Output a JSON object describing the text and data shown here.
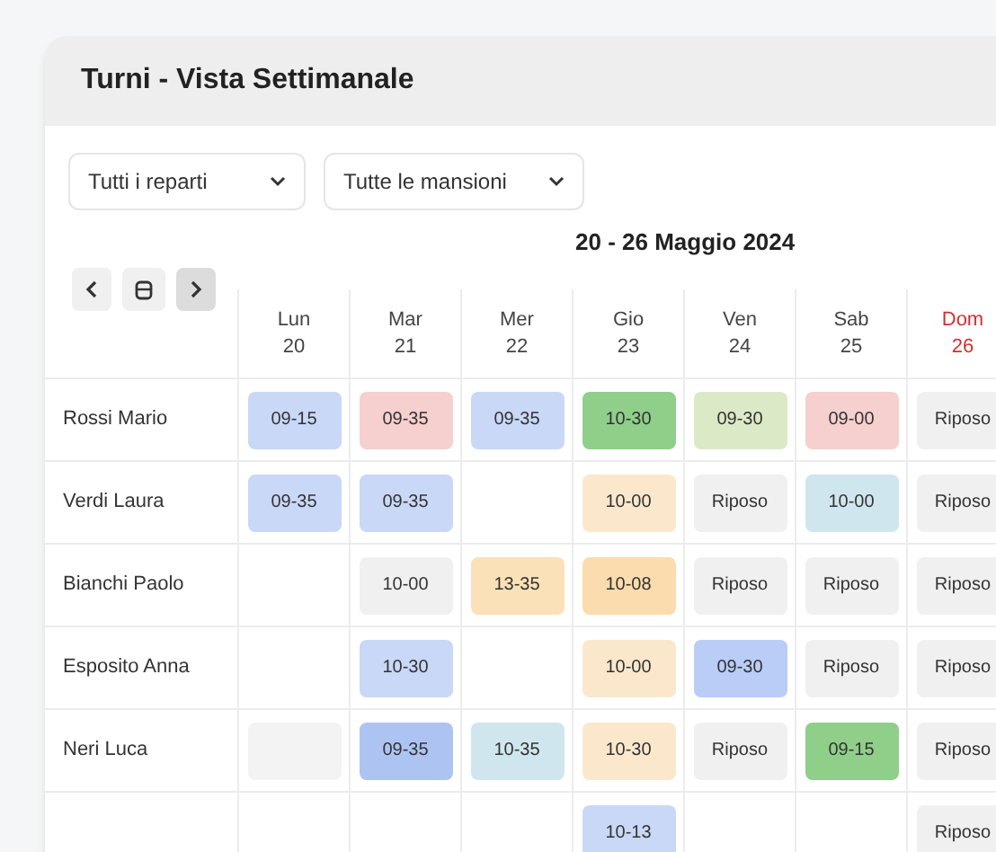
{
  "window": {
    "title": "Turni - Vista Settimanale"
  },
  "filters": [
    {
      "label": "Tutti i reparti"
    },
    {
      "label": "Tutte le mansioni"
    }
  ],
  "date_range": "20 - 26 Maggio 2024",
  "days": [
    {
      "name": "Lun",
      "date": "20",
      "holiday": false
    },
    {
      "name": "Mar",
      "date": "21",
      "holiday": false
    },
    {
      "name": "Mer",
      "date": "22",
      "holiday": false
    },
    {
      "name": "Gio",
      "date": "23",
      "holiday": false
    },
    {
      "name": "Ven",
      "date": "24",
      "holiday": false
    },
    {
      "name": "Sab",
      "date": "25",
      "holiday": false
    },
    {
      "name": "Dom",
      "date": "26",
      "holiday": true
    }
  ],
  "rows": [
    {
      "name": "Rossi Mario",
      "shifts": [
        {
          "kind": "shift",
          "text": "09-15",
          "color": "#c9d8f7"
        },
        {
          "kind": "shift",
          "text": "09-35",
          "color": "#f6cfcf"
        },
        {
          "kind": "shift",
          "text": "09-35",
          "color": "#c9d8f7"
        },
        {
          "kind": "shift",
          "text": "10-30",
          "color": "#8fcf8a"
        },
        {
          "kind": "shift",
          "text": "09-30",
          "color": "#dbe9c6"
        },
        {
          "kind": "shift",
          "text": "09-00",
          "color": "#f6cfcf"
        },
        {
          "kind": "shift",
          "text": "Riposo",
          "color": "#f0f0f0"
        }
      ]
    },
    {
      "name": "Verdi Laura",
      "shifts": [
        {
          "kind": "shift",
          "text": "09-35",
          "color": "#c9d8f7"
        },
        {
          "kind": "shift",
          "text": "09-35",
          "color": "#c9d8f7"
        },
        {
          "kind": "empty"
        },
        {
          "kind": "shift",
          "text": "10-00",
          "color": "#fbe8cc"
        },
        {
          "kind": "shift",
          "text": "Riposo",
          "color": "#f0f0f0"
        },
        {
          "kind": "shift",
          "text": "10-00",
          "color": "#cfe6ee"
        },
        {
          "kind": "shift",
          "text": "Riposo",
          "color": "#f0f0f0"
        }
      ]
    },
    {
      "name": "Bianchi Paolo",
      "shifts": [
        {
          "kind": "empty"
        },
        {
          "kind": "shift",
          "text": "10-00",
          "color": "#f0f0f0"
        },
        {
          "kind": "shift",
          "text": "13-35",
          "color": "#fbe1b8"
        },
        {
          "kind": "shift",
          "text": "10-08",
          "color": "#fbdcae"
        },
        {
          "kind": "shift",
          "text": "Riposo",
          "color": "#f0f0f0"
        },
        {
          "kind": "shift",
          "text": "Riposo",
          "color": "#f0f0f0"
        },
        {
          "kind": "shift",
          "text": "Riposo",
          "color": "#f0f0f0"
        }
      ]
    },
    {
      "name": "Esposito Anna",
      "shifts": [
        {
          "kind": "empty"
        },
        {
          "kind": "shift",
          "text": "10-30",
          "color": "#c9d8f7"
        },
        {
          "kind": "empty"
        },
        {
          "kind": "shift",
          "text": "10-00",
          "color": "#fbe8cc"
        },
        {
          "kind": "shift",
          "text": "09-30",
          "color": "#b9cdf7"
        },
        {
          "kind": "shift",
          "text": "Riposo",
          "color": "#f0f0f0"
        },
        {
          "kind": "shift",
          "text": "Riposo",
          "color": "#f0f0f0"
        }
      ]
    },
    {
      "name": "Neri Luca",
      "shifts": [
        {
          "kind": "blank",
          "color": "#f3f3f3"
        },
        {
          "kind": "shift",
          "text": "09-35",
          "color": "#adc4f3"
        },
        {
          "kind": "shift",
          "text": "10-35",
          "color": "#cfe6ee"
        },
        {
          "kind": "shift",
          "text": "10-30",
          "color": "#fbe8cc"
        },
        {
          "kind": "shift",
          "text": "Riposo",
          "color": "#f0f0f0"
        },
        {
          "kind": "shift",
          "text": "09-15",
          "color": "#8fcf8a"
        },
        {
          "kind": "shift",
          "text": "Riposo",
          "color": "#f0f0f0"
        }
      ]
    },
    {
      "shifts": [
        {
          "kind": "empty"
        },
        {
          "kind": "empty"
        },
        {
          "kind": "empty"
        },
        {
          "kind": "shift",
          "text": "10-13",
          "color": "#c9d8f7"
        },
        {
          "kind": "empty"
        },
        {
          "kind": "empty"
        },
        {
          "kind": "shift",
          "text": "Riposo",
          "color": "#f0f0f0"
        }
      ]
    }
  ]
}
